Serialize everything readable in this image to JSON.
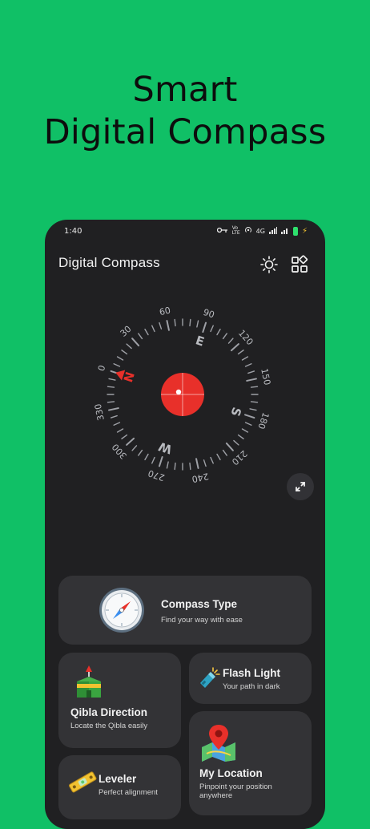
{
  "headline": {
    "line1": "Smart",
    "line2": "Digital Compass"
  },
  "status_bar": {
    "time": "1:40",
    "network": "4G"
  },
  "app_bar": {
    "title": "Digital Compass"
  },
  "compass": {
    "degree_labels": [
      "0",
      "30",
      "60",
      "90",
      "120",
      "150",
      "180",
      "210",
      "240",
      "270",
      "300",
      "330"
    ],
    "cardinals": [
      "N",
      "E",
      "S",
      "W"
    ],
    "needle_color": "#e8302a",
    "dial_color": "#9ea0a6"
  },
  "cards": {
    "compass_type": {
      "title": "Compass Type",
      "subtitle": "Find your way with ease"
    },
    "flash_light": {
      "title": "Flash Light",
      "subtitle": "Your path in dark"
    },
    "qibla": {
      "title": "Qibla Direction",
      "subtitle": "Locate the Qibla easily"
    },
    "location": {
      "title": "My Location",
      "subtitle_line1": "Pinpoint your position",
      "subtitle_line2": "anywhere"
    },
    "leveler": {
      "title": "Leveler",
      "subtitle": "Perfect alignment"
    }
  },
  "colors": {
    "background": "#10c066",
    "phone": "#202022",
    "card": "#333336"
  }
}
